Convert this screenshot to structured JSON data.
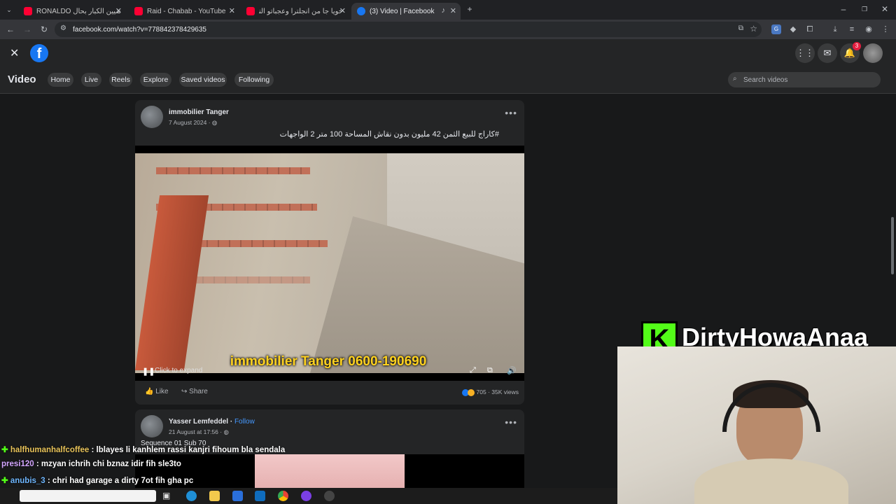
{
  "browser": {
    "tabs": [
      {
        "title": "RONALDO الرياضيين الكبار بحال..."
      },
      {
        "title": "Raid - Chabab - YouTube"
      },
      {
        "title": "خويا جا من انجلترا وعجباتو النجيلة"
      },
      {
        "title": "(3) Video | Facebook"
      }
    ],
    "url": "facebook.com/watch?v=778842378429635"
  },
  "fb": {
    "notif_count": "3",
    "section_title": "Video",
    "nav": [
      "Home",
      "Live",
      "Reels",
      "Explore",
      "Saved videos",
      "Following"
    ],
    "search_placeholder": "Search videos"
  },
  "post1": {
    "author": "immobilier Tanger",
    "date": "7 August 2024 · ",
    "text": "#كاراج للبيع الثمن 42 مليون بدون نقاش المساحة 100 متر 2 الواجهات",
    "video_caption": "immobilier Tanger 0600-190690",
    "expand_label": "Click to expand",
    "like_label": "Like",
    "share_label": "Share",
    "reactions": "705",
    "views": "35K views"
  },
  "post2": {
    "author": "Yasser Lemfeddel",
    "follow_label": "Follow",
    "date": "21 August at 17:56 · ",
    "text": "Sequence 01 Sub 70"
  },
  "stream": {
    "brand": "DirtyHowaAnaa",
    "chat": [
      {
        "user": "halfhumanhalfcoffee",
        "msg": " : lblayes li kanhlem rassi kanjri fihoum bla sendala"
      },
      {
        "user": "presi120",
        "msg": " : mzyan ichrih chi bznaz idir fih sle3to"
      },
      {
        "user": "anubis_3",
        "msg": " : chri had garage a dirty 7ot fih gha pc"
      }
    ]
  },
  "colors": {
    "fb_blue": "#1877f2",
    "kick_green": "#53fc18",
    "caption_yellow": "#ffd21f"
  }
}
